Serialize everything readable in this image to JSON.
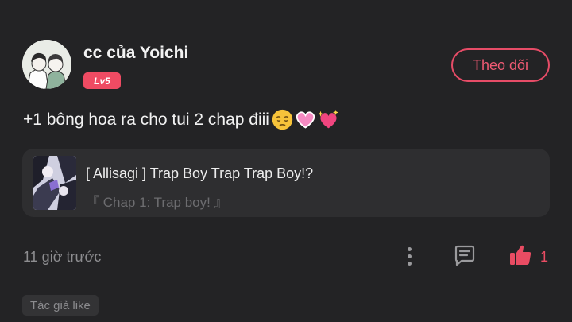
{
  "comment": {
    "username": "cc của Yoichi",
    "level": "Lv5",
    "follow_label": "Theo dõi",
    "text": "+1 bông hoa ra cho tui 2 chap điii",
    "emojis": [
      "pensive-face",
      "pink-heart",
      "sparkling-heart"
    ],
    "manga": {
      "title": "[ Allisagi ] Trap Boy Trap Trap Boy!?",
      "chapter": "『 Chap 1: Trap boy! 』"
    },
    "timestamp": "11 giờ trước",
    "like_count": "1",
    "author_like_label": "Tác giả like"
  },
  "colors": {
    "background": "#232325",
    "card": "#2e2e30",
    "accent": "#e94c63",
    "level_badge": "#ef4b63",
    "text_primary": "#f2f2f2",
    "text_muted": "#8d8d90"
  },
  "icons": {
    "more": "vertical-ellipsis-icon",
    "reply": "comment-icon",
    "like": "thumbs-up-icon"
  }
}
